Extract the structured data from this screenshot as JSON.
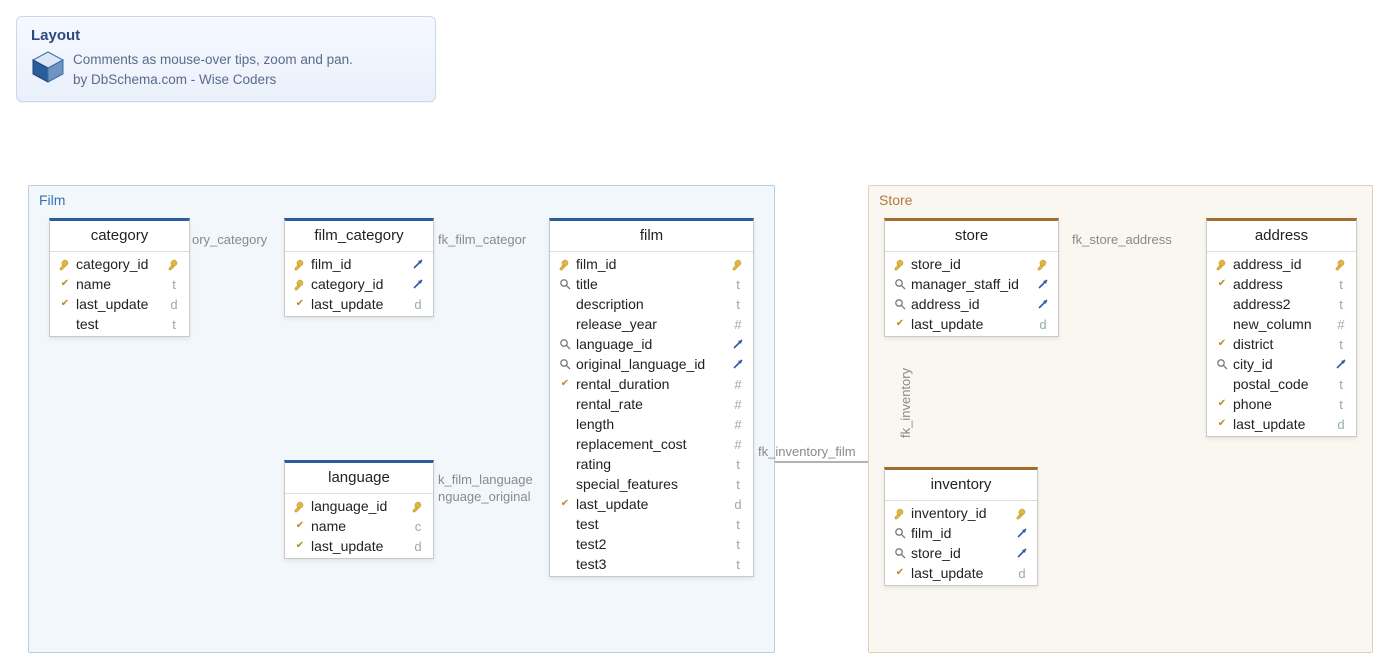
{
  "info": {
    "title": "Layout",
    "line1": "Comments as mouse-over tips, zoom and pan.",
    "line2": "by DbSchema.com - Wise Coders"
  },
  "groups": {
    "film": "Film",
    "store": "Store"
  },
  "icons": {
    "key": "key-icon",
    "idx": "index-glass-icon",
    "fk": "fk-arrow-icon",
    "t": "t",
    "d": "d",
    "hash": "#",
    "c": "c"
  },
  "relations": {
    "cat": "ory_category",
    "filmcat": "fk_film_categor",
    "filmlang": "k_film_language",
    "filmlang2": "nguage_original",
    "invfilm": "fk_inventory_film",
    "inv": "fk_inventory",
    "storeaddr": "fk_store_address"
  },
  "tables": {
    "category": {
      "title": "category",
      "cols": [
        {
          "l": "key",
          "n": "category_id",
          "r": "keytick"
        },
        {
          "l": "tick",
          "n": "name",
          "r": "t"
        },
        {
          "l": "tick",
          "n": "last_update",
          "r": "d"
        },
        {
          "l": "",
          "n": "test",
          "r": "t"
        }
      ]
    },
    "film_category": {
      "title": "film_category",
      "cols": [
        {
          "l": "key",
          "n": "film_id",
          "r": "fk"
        },
        {
          "l": "key",
          "n": "category_id",
          "r": "fk"
        },
        {
          "l": "tick",
          "n": "last_update",
          "r": "d"
        }
      ]
    },
    "film": {
      "title": "film",
      "cols": [
        {
          "l": "key",
          "n": "film_id",
          "r": "keytick"
        },
        {
          "l": "idx",
          "n": "title",
          "r": "t"
        },
        {
          "l": "",
          "n": "description",
          "r": "t"
        },
        {
          "l": "",
          "n": "release_year",
          "r": "hash"
        },
        {
          "l": "idx",
          "n": "language_id",
          "r": "fk"
        },
        {
          "l": "idx",
          "n": "original_language_id",
          "r": "fk"
        },
        {
          "l": "tick",
          "n": "rental_duration",
          "r": "hash"
        },
        {
          "l": "",
          "n": "rental_rate",
          "r": "hash"
        },
        {
          "l": "",
          "n": "length",
          "r": "hash"
        },
        {
          "l": "",
          "n": "replacement_cost",
          "r": "hash"
        },
        {
          "l": "",
          "n": "rating",
          "r": "t"
        },
        {
          "l": "",
          "n": "special_features",
          "r": "t"
        },
        {
          "l": "tick",
          "n": "last_update",
          "r": "d"
        },
        {
          "l": "",
          "n": "test",
          "r": "t"
        },
        {
          "l": "",
          "n": "test2",
          "r": "t"
        },
        {
          "l": "",
          "n": "test3",
          "r": "t"
        }
      ]
    },
    "language": {
      "title": "language",
      "cols": [
        {
          "l": "key",
          "n": "language_id",
          "r": "keytick"
        },
        {
          "l": "tick",
          "n": "name",
          "r": "c"
        },
        {
          "l": "tick",
          "n": "last_update",
          "r": "d"
        }
      ]
    },
    "store": {
      "title": "store",
      "cols": [
        {
          "l": "key",
          "n": "store_id",
          "r": "keytick"
        },
        {
          "l": "idx",
          "n": "manager_staff_id",
          "r": "fk"
        },
        {
          "l": "idx",
          "n": "address_id",
          "r": "fk"
        },
        {
          "l": "tick",
          "n": "last_update",
          "r": "d"
        }
      ]
    },
    "address": {
      "title": "address",
      "cols": [
        {
          "l": "key",
          "n": "address_id",
          "r": "keytick"
        },
        {
          "l": "tick",
          "n": "address",
          "r": "t"
        },
        {
          "l": "",
          "n": "address2",
          "r": "t"
        },
        {
          "l": "",
          "n": "new_column",
          "r": "hash"
        },
        {
          "l": "tick",
          "n": "district",
          "r": "t"
        },
        {
          "l": "idx",
          "n": "city_id",
          "r": "fk"
        },
        {
          "l": "",
          "n": "postal_code",
          "r": "t"
        },
        {
          "l": "tick",
          "n": "phone",
          "r": "t"
        },
        {
          "l": "tick",
          "n": "last_update",
          "r": "d"
        }
      ]
    },
    "inventory": {
      "title": "inventory",
      "cols": [
        {
          "l": "key",
          "n": "inventory_id",
          "r": "keytick"
        },
        {
          "l": "idx",
          "n": "film_id",
          "r": "fk"
        },
        {
          "l": "idx",
          "n": "store_id",
          "r": "fk"
        },
        {
          "l": "tick",
          "n": "last_update",
          "r": "d"
        }
      ]
    }
  }
}
